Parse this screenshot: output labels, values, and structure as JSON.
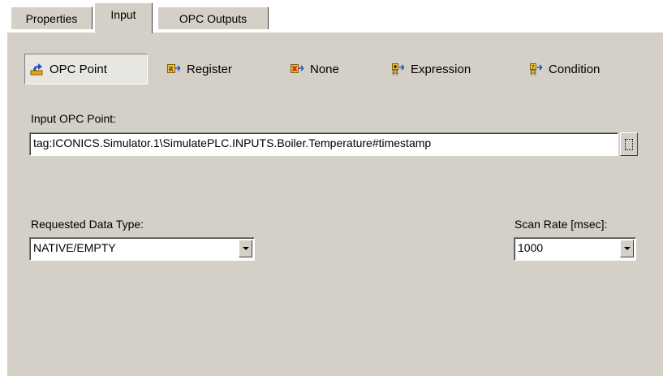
{
  "tabs": [
    {
      "label": "Properties"
    },
    {
      "label": "Input"
    },
    {
      "label": "OPC Outputs"
    }
  ],
  "source_options": [
    {
      "label": "OPC Point",
      "icon": "opc-point-icon",
      "selected": true
    },
    {
      "label": "Register",
      "icon": "register-icon",
      "selected": false
    },
    {
      "label": "None",
      "icon": "none-icon",
      "selected": false
    },
    {
      "label": "Expression",
      "icon": "expression-icon",
      "selected": false
    },
    {
      "label": "Condition",
      "icon": "condition-icon",
      "selected": false
    }
  ],
  "input_point": {
    "label": "Input OPC Point:",
    "value": "tag:ICONICS.Simulator.1\\SimulatePLC.INPUTS.Boiler.Temperature#timestamp"
  },
  "data_type": {
    "label": "Requested Data Type:",
    "value": "NATIVE/EMPTY"
  },
  "scan_rate": {
    "label": "Scan Rate [msec]:",
    "value": "1000"
  },
  "colors": {
    "face": "#d4d0c8",
    "icon_orange": "#f0a000",
    "icon_red": "#d02020",
    "icon_blue": "#2050c0"
  }
}
